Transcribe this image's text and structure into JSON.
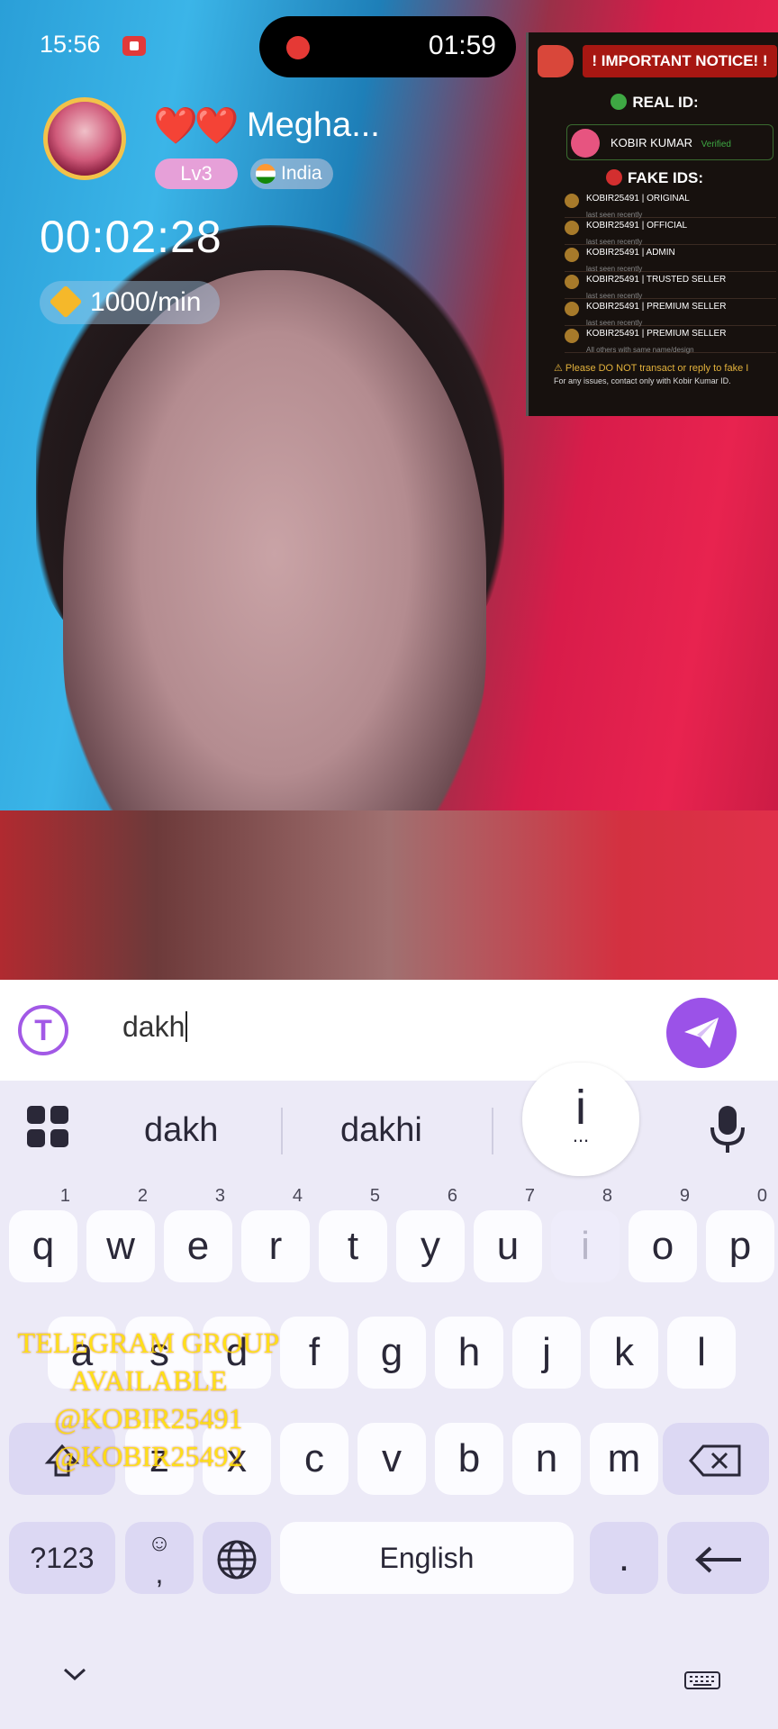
{
  "status_bar": {
    "time": "15:56"
  },
  "recording": {
    "time": "01:59"
  },
  "host": {
    "hearts": "❤️❤️",
    "name": "Megha...",
    "level": "Lv3",
    "country": "India"
  },
  "call": {
    "duration": "00:02:28",
    "rate": "1000/min"
  },
  "notice": {
    "title": "IMPORTANT NOTICE!",
    "real_heading": "REAL ID:",
    "real_id": "KOBIR KUMAR",
    "real_badge": "Verified",
    "fake_heading": "FAKE IDS:",
    "fake_ids": [
      {
        "id": "KOBIR25491 | ORIGINAL",
        "note": "last seen recently"
      },
      {
        "id": "KOBIR25491 | OFFICIAL",
        "note": "last seen recently"
      },
      {
        "id": "KOBIR25491 | ADMIN",
        "note": "last seen recently"
      },
      {
        "id": "KOBIR25491 | TRUSTED SELLER",
        "note": "last seen recently"
      },
      {
        "id": "KOBIR25491 | PREMIUM SELLER",
        "note": "last seen recently"
      },
      {
        "id": "KOBIR25491 | PREMIUM SELLER",
        "note": "All others with same name/design"
      }
    ],
    "footer1": "Please DO NOT transact or reply to fake I",
    "footer2": "For any issues, contact only with Kobir Kumar ID."
  },
  "input": {
    "value": "dakh"
  },
  "keyboard": {
    "suggestions": [
      "dakh",
      "dakhi"
    ],
    "popup_key": "i",
    "popup_dots": "...",
    "row1": [
      [
        "q",
        "1"
      ],
      [
        "w",
        "2"
      ],
      [
        "e",
        "3"
      ],
      [
        "r",
        "4"
      ],
      [
        "t",
        "5"
      ],
      [
        "y",
        "6"
      ],
      [
        "u",
        "7"
      ],
      [
        "i",
        "8"
      ],
      [
        "o",
        "9"
      ],
      [
        "p",
        "0"
      ]
    ],
    "row2": [
      "a",
      "s",
      "d",
      "f",
      "g",
      "h",
      "j",
      "k",
      "l"
    ],
    "row3": [
      "z",
      "x",
      "c",
      "v",
      "b",
      "n",
      "m"
    ],
    "symbols": "?123",
    "emoji_comma": ",",
    "space": "English",
    "period": "."
  },
  "overlay_text": [
    "TELEGRAM GROUP",
    "AVAILABLE",
    "@KOBIR25491",
    "@KOBIR25492"
  ],
  "colors": {
    "accent": "#9b52e8",
    "keyboard_bg": "#eceaf7",
    "notice_red": "#a71712"
  }
}
